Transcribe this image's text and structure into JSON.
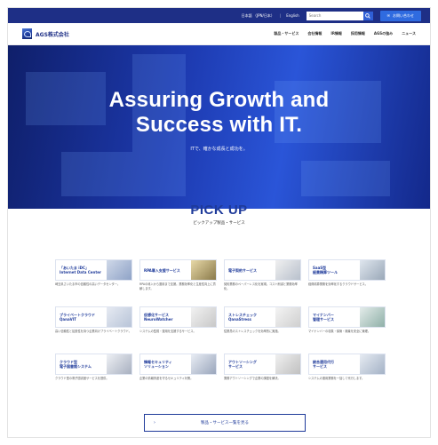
{
  "utility": {
    "lang_ja": "日本語",
    "lang_ja_note": "（JPN/日本）",
    "lang_en": "English",
    "search_placeholder": "Search",
    "contact_label": "お問い合わせ"
  },
  "header": {
    "logo_text": "AGS株式会社",
    "nav": [
      "製品・サービス",
      "会社情報",
      "IR情報",
      "採用情報",
      "AGSの強み",
      "ニュース"
    ]
  },
  "hero": {
    "title_line1": "Assuring Growth and",
    "title_line2": "Success with IT.",
    "subtitle": "ITで、確かな成長と成功を。"
  },
  "pickup": {
    "title": "PICK UP",
    "subtitle": "ピックアップ製品・サービス"
  },
  "cards": [
    {
      "title": "「あいたま iDC」",
      "title2": "Internet Data Center",
      "desc": "埼玉県さいたま市の信頼性の高いデータセンター。"
    },
    {
      "title": "RPA導入支援サービス",
      "title2": "",
      "desc": "RPAの導入から運用まで支援。業務効率化と生産性向上に貢献します。"
    },
    {
      "title": "電子契約サービス",
      "title2": "",
      "desc": "契約業務のペーパーレス化を実現。コスト削減と業務効率化。"
    },
    {
      "title": "SaaS型",
      "title2": "経費精算ツール",
      "desc": "経費精算業務を効率化するクラウドサービス。"
    },
    {
      "title": "プライベートクラウド",
      "title2": "QanaVIT",
      "desc": "高い信頼性と拡張性を持つ企業向けプライベートクラウド。"
    },
    {
      "title": "仮想化サービス",
      "title2": "NeuroWatcher",
      "desc": "システムの監視・運用を支援するサービス。"
    },
    {
      "title": "ストレスチェック",
      "title2": "QanaStress",
      "desc": "従業員のストレスチェックを効率的に実施。"
    },
    {
      "title": "マイナンバー",
      "title2": "管理サービス",
      "desc": "マイナンバーの収集・保管・廃棄を安全に管理。"
    },
    {
      "title": "クラウド型",
      "title2": "電子図書館システム",
      "desc": "クラウド型の電子図書館サービスを提供。"
    },
    {
      "title": "情報セキュリティ",
      "title2": "ソリューション",
      "desc": "企業の情報資産を守るセキュリティ対策。"
    },
    {
      "title": "アウトソーシング",
      "title2": "サービス",
      "desc": "業務アウトソーシングで企業の課題を解決。"
    },
    {
      "title": "統合運用代行",
      "title2": "サービス",
      "desc": "システムの運用業務を一括して代行します。"
    }
  ],
  "more_button": "製品・サービス一覧を見る",
  "colors": {
    "brand": "#1e2f86",
    "accent": "#2f6be0",
    "pickup_title": "#1e3a9a"
  }
}
